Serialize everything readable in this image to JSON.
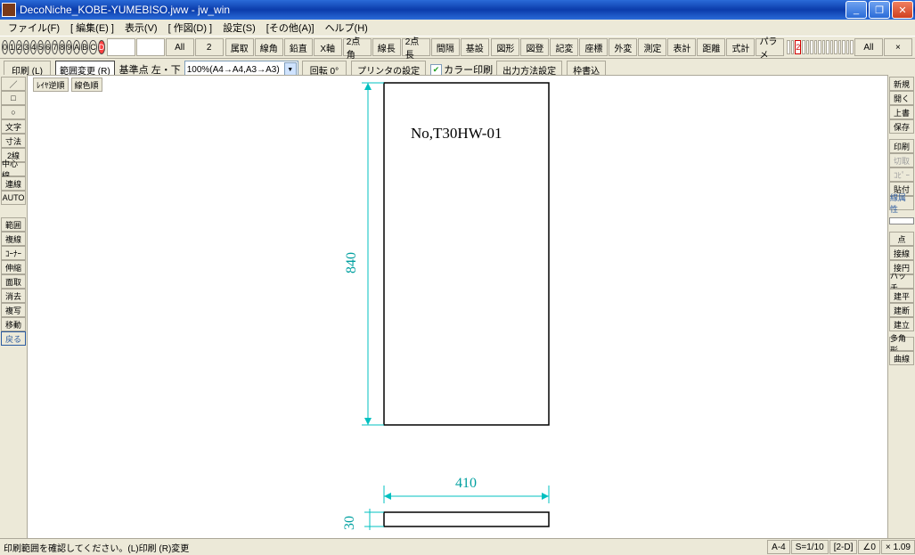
{
  "title": "DecoNiche_KOBE-YUMEBISO.jww - jw_win",
  "menu": [
    "ファイル(F)",
    "[ 編集(E) ]",
    "表示(V)",
    "[ 作図(D) ]",
    "設定(S)",
    "[その他(A)]",
    "ヘルプ(H)"
  ],
  "layerbtns": [
    "0",
    "1",
    "2",
    "3",
    "4",
    "5",
    "6",
    "7",
    "8",
    "9",
    "A",
    "B",
    "C",
    "D"
  ],
  "layer_all": "All",
  "layer_set": "2",
  "toprow": [
    "属取",
    "線角",
    "鉛直",
    "X軸",
    "2点角",
    "線長",
    "2点長",
    "間隔",
    "基設"
  ],
  "toprow2": [
    "図形",
    "図登",
    "記変",
    "座標",
    "外変",
    "測定",
    "表計",
    "距離",
    "式計",
    "パラメ"
  ],
  "tabidx": "2",
  "tab_all": "All",
  "tab_x": "×",
  "sub": {
    "print": "印刷 (L)",
    "range": "範囲変更 (R)",
    "basept": "基準点 左・下",
    "zoom": "100%(A4→A4,A3→A3)",
    "rotate": "回転 0°",
    "printer": "プリンタの設定",
    "colorprint": "カラー印刷",
    "output": "出力方法設定",
    "wakugaki": "枠書込"
  },
  "canvasbtns": [
    "ﾚｲﾔ逆順",
    "線色順"
  ],
  "left": [
    "／",
    "□",
    "○",
    "文字",
    "寸法",
    "2線",
    "中心線",
    "連線",
    "AUTO",
    "",
    "範囲",
    "複線",
    "ｺｰﾅｰ",
    "伸縮",
    "面取",
    "消去",
    "複写",
    "移動",
    "戻る"
  ],
  "right": [
    "新規",
    "開く",
    "上書",
    "保存",
    "",
    "印刷",
    "切取",
    "ｺﾋﾟｰ",
    "貼付",
    "線属性",
    "",
    "",
    "",
    "",
    "点",
    "接線",
    "接円",
    "ハッチ",
    "建平",
    "建断",
    "建立",
    "",
    "多角形",
    "曲線"
  ],
  "drawing": {
    "label": "No,T30HW-01",
    "dim_v": "840",
    "dim_h": "410",
    "dim_s": "30"
  },
  "status": {
    "msg": "印刷範囲を確認してください。(L)印刷 (R)変更",
    "paper": "A-4",
    "scale": "S=1/10",
    "layer": "[2-D]",
    "angle": "∠0",
    "mult": "× 1.09"
  }
}
